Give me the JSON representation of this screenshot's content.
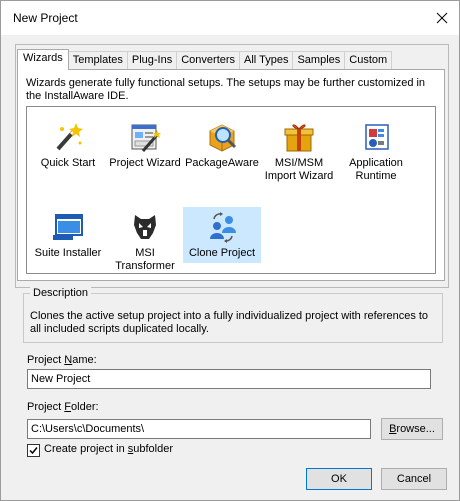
{
  "window": {
    "title": "New Project"
  },
  "tabs": [
    {
      "label": "Wizards"
    },
    {
      "label": "Templates"
    },
    {
      "label": "Plug-Ins"
    },
    {
      "label": "Converters"
    },
    {
      "label": "All Types"
    },
    {
      "label": "Samples"
    },
    {
      "label": "Custom"
    }
  ],
  "wizards": {
    "description": "Wizards generate fully functional setups. The setups may be further customized in the InstallAware IDE.",
    "items": [
      {
        "label": "Quick Start"
      },
      {
        "label": "Project Wizard"
      },
      {
        "label": "PackageAware"
      },
      {
        "label": "MSI/MSM Import Wizard"
      },
      {
        "label": "Application Runtime"
      },
      {
        "label": "Suite Installer"
      },
      {
        "label": "MSI Transformer"
      },
      {
        "label": "Clone Project"
      }
    ],
    "selected": "Clone Project"
  },
  "description": {
    "legend": "Description",
    "text": "Clones the active setup project into a fully individualized project with references to all included scripts duplicated locally."
  },
  "form": {
    "name_label_pre": "Project ",
    "name_label_key": "N",
    "name_label_post": "ame:",
    "name_value": "New Project",
    "folder_label_pre": "Project ",
    "folder_label_key": "F",
    "folder_label_post": "older:",
    "folder_value": "C:\\Users\\c\\Documents\\",
    "browse_pre": "",
    "browse_key": "B",
    "browse_post": "rowse...",
    "subfolder_pre": "Create project in ",
    "subfolder_key": "s",
    "subfolder_post": "ubfolder",
    "subfolder_checked": true
  },
  "buttons": {
    "ok": "OK",
    "cancel": "Cancel"
  }
}
